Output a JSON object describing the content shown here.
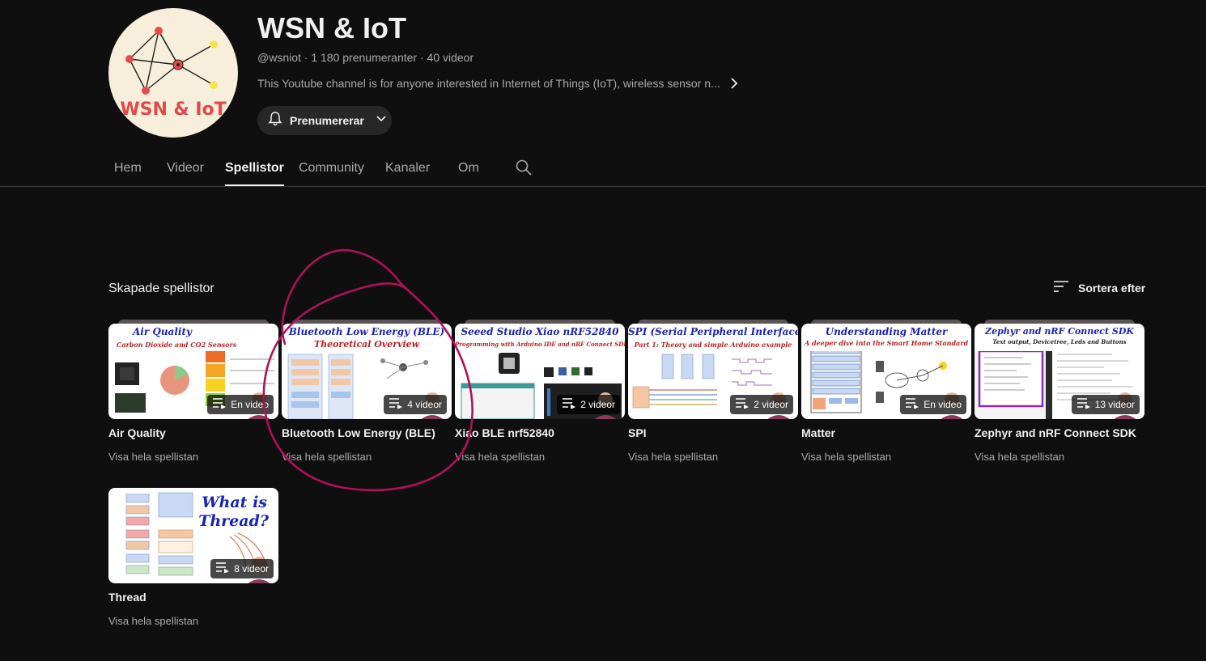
{
  "channel": {
    "title": "WSN & IoT",
    "logo_text": "WSN & IoT",
    "meta": "@wsniot · 1 180 prenumeranter · 40 videor",
    "description": "This Youtube channel is for anyone interested in Internet of Things (IoT), wireless sensor n...",
    "subscribe_label": "Prenumererar"
  },
  "tabs": [
    {
      "label": "Hem"
    },
    {
      "label": "Videor"
    },
    {
      "label": "Spellistor",
      "active": true
    },
    {
      "label": "Community"
    },
    {
      "label": "Kanaler"
    },
    {
      "label": "Om"
    }
  ],
  "section": {
    "title": "Skapade spellistor",
    "sort_label": "Sortera efter"
  },
  "playlists": [
    {
      "thumb_line1": "Air Quality",
      "thumb_line2": "Carbon Dioxide and CO2 Sensors",
      "count": "En video",
      "title": "Air Quality",
      "link": "Visa hela spellistan"
    },
    {
      "thumb_line1": "Bluetooth Low Energy (BLE)",
      "thumb_line2": "Theoretical Overview",
      "count": "4 videor",
      "title": "Bluetooth Low Energy (BLE)",
      "link": "Visa hela spellistan"
    },
    {
      "thumb_line1": "Seeed Studio Xiao nRF52840",
      "thumb_line2": "Programming with Arduino IDE and nRF Connect SDK",
      "count": "2 videor",
      "title": "Xiao BLE nrf52840",
      "link": "Visa hela spellistan"
    },
    {
      "thumb_line1": "SPI (Serial Peripheral Interface)",
      "thumb_line2": "Part 1: Theory and simple Arduino example",
      "count": "2 videor",
      "title": "SPI",
      "link": "Visa hela spellistan"
    },
    {
      "thumb_line1": "Understanding Matter",
      "thumb_line2": "A deeper dive into the Smart Home Standard",
      "count": "En video",
      "title": "Matter",
      "link": "Visa hela spellistan"
    },
    {
      "thumb_line1": "Zephyr and nRF Connect SDK",
      "thumb_line2": "Text output, Devicetree, Leds and Buttons",
      "count": "13 videor",
      "title": "Zephyr and nRF Connect SDK",
      "link": "Visa hela spellistan"
    },
    {
      "thumb_line1": "What is",
      "thumb_line2": "Thread?",
      "count": "8 videor",
      "title": "Thread",
      "link": "Visa hela spellistan"
    }
  ],
  "colors": {
    "background": "#0f0f0f",
    "annotation": "#b0105a",
    "thumb_title": "#1a23b8",
    "thumb_subtitle": "#c02020"
  }
}
